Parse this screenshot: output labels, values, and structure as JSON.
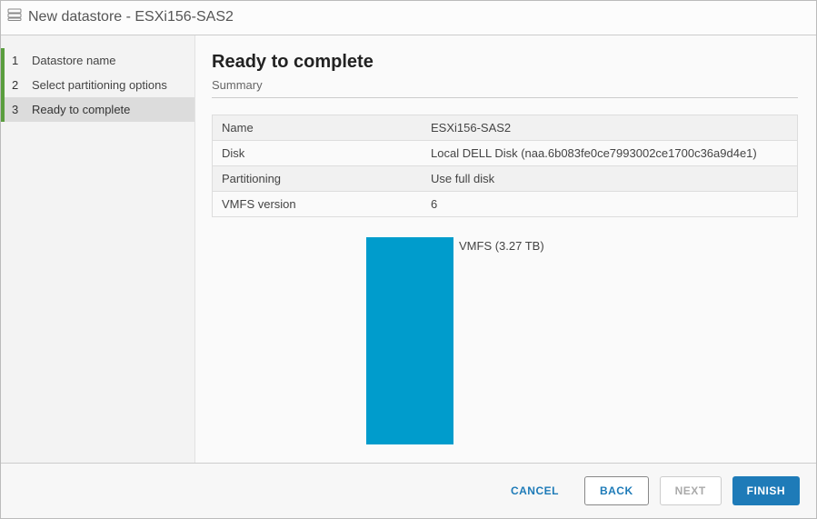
{
  "title": "New datastore - ESXi156-SAS2",
  "steps": [
    {
      "num": "1",
      "label": "Datastore name"
    },
    {
      "num": "2",
      "label": "Select partitioning options"
    },
    {
      "num": "3",
      "label": "Ready to complete"
    }
  ],
  "heading": "Ready to complete",
  "summary_label": "Summary",
  "summary": {
    "name_key": "Name",
    "name_val": "ESXi156-SAS2",
    "disk_key": "Disk",
    "disk_val": "Local DELL Disk (naa.6b083fe0ce7993002ce1700c36a9d4e1)",
    "part_key": "Partitioning",
    "part_val": "Use full disk",
    "vmfs_key": "VMFS version",
    "vmfs_val": "6"
  },
  "disk_graphic_label": "VMFS  (3.27 TB)",
  "footer": {
    "cancel": "CANCEL",
    "back": "BACK",
    "next": "NEXT",
    "finish": "FINISH"
  }
}
